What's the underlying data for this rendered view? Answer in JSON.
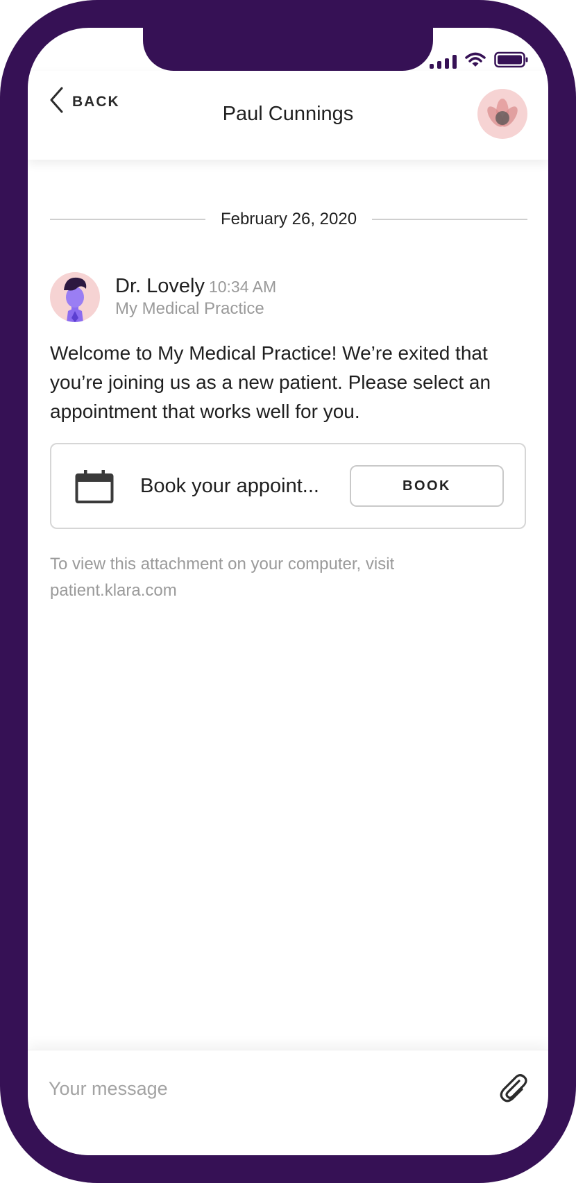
{
  "status_bar": {
    "signal_icon": "cellular-signal-icon",
    "wifi_icon": "wifi-icon",
    "battery_icon": "battery-icon"
  },
  "header": {
    "back_label": "BACK",
    "back_icon": "chevron-left-icon",
    "title": "Paul Cunnings",
    "avatar_icon": "lotus-logo-icon"
  },
  "conversation": {
    "date": "February 26, 2020",
    "sender": {
      "name": "Dr. Lovely",
      "time": "10:34 AM",
      "practice": "My Medical Practice"
    },
    "message": "Welcome to My Medical Practice! We’re exited that you’re joining us as a new patient. Please select an appointment that works well for you.",
    "attachment": {
      "icon": "calendar-icon",
      "label": "Book your appoint...",
      "button_label": "BOOK"
    },
    "attachment_note": "To view this attachment on your computer, visit patient.klara.com"
  },
  "composer": {
    "placeholder": "Your message",
    "attach_icon": "paperclip-icon"
  },
  "colors": {
    "frame": "#361155",
    "avatar_bg": "#f6d3d3",
    "doctor_accent": "#8b6cf0",
    "muted_text": "#9a9a9a"
  }
}
